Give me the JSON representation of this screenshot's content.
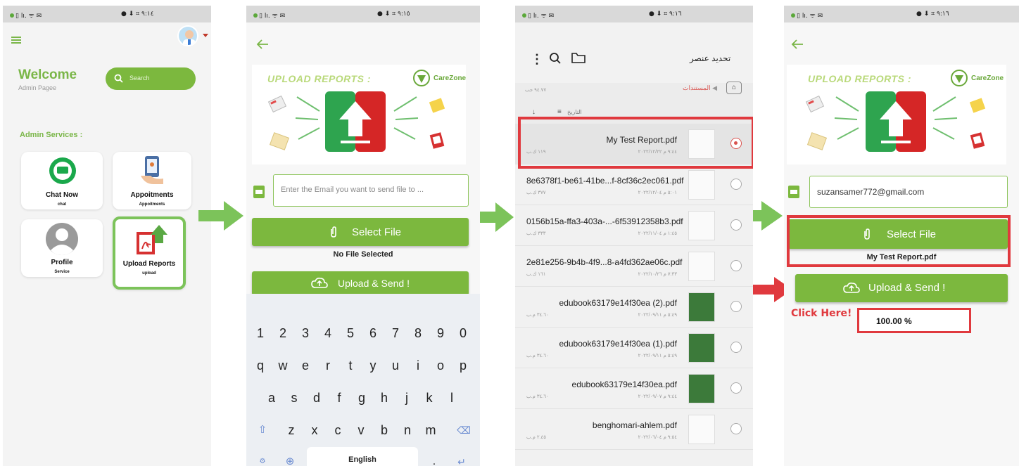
{
  "status_bar": {
    "left": "▯ lı. ᯤ ✉",
    "right_1": "● ⬇ ⌗ ٩:١٤",
    "right_2": "● ⬇ ⌗ ٩:١٥",
    "right_3": "● ⬇ ⌗ ٩:١٦",
    "right_4": "● ⬇ ⌗ ٩:١٦"
  },
  "screen1": {
    "welcome": "Welcome",
    "subtitle": "Admin Pagee",
    "search_placeholder": "Search",
    "section_title": "Admin Services :",
    "cards": [
      {
        "title": "Chat Now",
        "sub": "chat"
      },
      {
        "title": "Appoitments",
        "sub": "Appoitments"
      },
      {
        "title": "Profile",
        "sub": "Service"
      },
      {
        "title": "Upload Reports",
        "sub": "upload"
      }
    ]
  },
  "banner": {
    "title": "UPLOAD REPORTS :",
    "brand": "CareZone"
  },
  "screen2": {
    "email_placeholder": "Enter the Email you want to send file to ...",
    "select_file": "Select File",
    "no_file": "No File Selected",
    "upload_send": "Upload & Send !",
    "keyboard": {
      "row1": [
        "1",
        "2",
        "3",
        "4",
        "5",
        "6",
        "7",
        "8",
        "9",
        "0"
      ],
      "row2": [
        "q",
        "w",
        "e",
        "r",
        "t",
        "y",
        "u",
        "i",
        "o",
        "p"
      ],
      "row3": [
        "a",
        "s",
        "d",
        "f",
        "g",
        "h",
        "j",
        "k",
        "l"
      ],
      "row4": [
        "z",
        "x",
        "c",
        "v",
        "b",
        "n",
        "m"
      ],
      "space_label": "English",
      "period": "."
    }
  },
  "screen3": {
    "header_title": "تحديد عنصر",
    "breadcrumb": "المستندات",
    "storage": "٩٤.٧٧ جب",
    "sort_label": "التاريخ",
    "files": [
      {
        "name": "My Test Report.pdf",
        "size": "١١٩ ك.ب",
        "date": "٩:٤٤ م ٢٠٢٢/١٢/٢٢"
      },
      {
        "name": "8e6378f1-be61-41be...f-8cf36c2ec061.pdf",
        "size": "٣٧٧ ك.ب",
        "date": "٥:٠١ م ٢٠٢٢/١٢/٠٤"
      },
      {
        "name": "0156b15a-ffa3-403a-...-6f53912358b3.pdf",
        "size": "٣٣٣ ك.ب",
        "date": "١:٤٥ م ٢٠٢٢/١١/٠٤"
      },
      {
        "name": "2e81e256-9b4b-4f9...8-a4fd362ae06c.pdf",
        "size": "١٦١ ك.ب",
        "date": "٧:٣٣ م ٢٠٢٢/١٠/٢٦"
      },
      {
        "name": "edubook63179e14f30ea (2).pdf",
        "size": "٣٤.٦٠ م.ب",
        "date": "٥:٤٩ م ٢٠٢٢/٠٩/١١"
      },
      {
        "name": "edubook63179e14f30ea (1).pdf",
        "size": "٣٤.٦٠ م.ب",
        "date": "٥:٤٩ م ٢٠٢٢/٠٩/١١"
      },
      {
        "name": "edubook63179e14f30ea.pdf",
        "size": "٣٤.٦٠ م.ب",
        "date": "٩:٤٤ م ٢٠٢٢/٠٩/٠٧"
      },
      {
        "name": "benghomari-ahlem.pdf",
        "size": "٢.٤٥ م.ب",
        "date": "٩:٥٤ م ٢٠٢٢/٠٦/٠٤"
      }
    ]
  },
  "screen4": {
    "email_value": "suzansamer772@gmail.com",
    "select_file": "Select File",
    "file_name": "My Test Report.pdf",
    "upload_send": "Upload & Send !",
    "click_here": "Click Here!",
    "progress": "100.00 %"
  },
  "colors": {
    "accent_green": "#7cb83e",
    "highlight_red": "#e0393e"
  }
}
